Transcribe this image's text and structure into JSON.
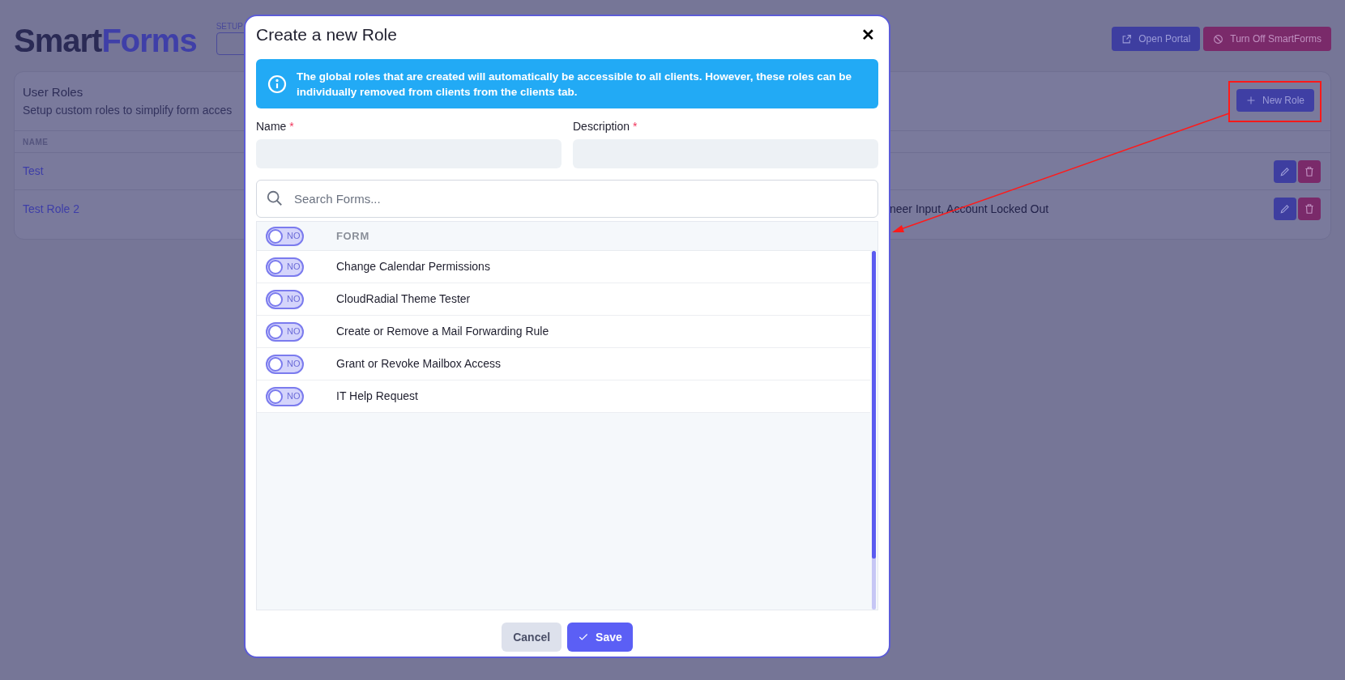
{
  "page": {
    "logo": {
      "part_1": "Smart",
      "part_2": "Forms"
    },
    "setup_label": "SETUP",
    "buttons": [
      {
        "kind": "portal",
        "label": "Open Portal"
      },
      {
        "kind": "turn_off",
        "label": "Turn Off SmartForms"
      }
    ],
    "card": {
      "title": "User Roles",
      "subtitle": "Setup custom roles to simplify form acces",
      "new_button": "New Role",
      "columns": [
        "NAME"
      ],
      "rows": [
        {
          "name": "Test",
          "column_2": ""
        },
        {
          "name": "Test Role 2",
          "column_2": "neer Input, Account Locked Out"
        }
      ]
    }
  },
  "modal": {
    "title": "Create a new Role",
    "close": "✕",
    "info": "The global roles that are created will automatically be accessible to all clients. However, these roles can be individually removed from clients from the clients tab.",
    "fields": [
      {
        "label": "Name",
        "required_mark": "*"
      },
      {
        "label": "Description",
        "required_mark": "*"
      }
    ],
    "search": {
      "placeholder": "Search Forms..."
    },
    "table": {
      "header_toggle": {
        "label": "NO",
        "on": false
      },
      "header": "FORM",
      "rows": [
        {
          "toggle_label": "NO",
          "on": false,
          "name": "Change Calendar Permissions"
        },
        {
          "toggle_label": "NO",
          "on": false,
          "name": "CloudRadial Theme Tester"
        },
        {
          "toggle_label": "NO",
          "on": false,
          "name": "Create or Remove a Mail Forwarding Rule"
        },
        {
          "toggle_label": "NO",
          "on": false,
          "name": "Grant or Revoke Mailbox Access"
        },
        {
          "toggle_label": "NO",
          "on": false,
          "name": "IT Help Request"
        }
      ]
    },
    "buttons": [
      {
        "kind": "cancel",
        "label": "Cancel"
      },
      {
        "kind": "save",
        "label": "Save"
      }
    ]
  }
}
